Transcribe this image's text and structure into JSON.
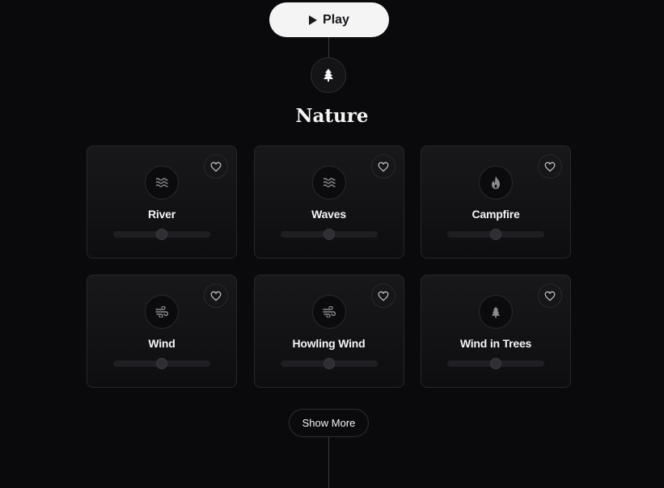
{
  "player": {
    "play_label": "Play",
    "play_icon": "play-icon"
  },
  "category": {
    "title": "Nature",
    "icon": "tree-icon"
  },
  "sounds": [
    {
      "name": "River",
      "icon": "waves-icon",
      "volume": 0.5,
      "favorited": false
    },
    {
      "name": "Waves",
      "icon": "waves-icon",
      "volume": 0.5,
      "favorited": false
    },
    {
      "name": "Campfire",
      "icon": "flame-icon",
      "volume": 0.5,
      "favorited": false
    },
    {
      "name": "Wind",
      "icon": "wind-icon",
      "volume": 0.5,
      "favorited": false
    },
    {
      "name": "Howling Wind",
      "icon": "wind-icon",
      "volume": 0.5,
      "favorited": false
    },
    {
      "name": "Wind in Trees",
      "icon": "tree-icon",
      "volume": 0.5,
      "favorited": false
    }
  ],
  "show_more_label": "Show More",
  "colors": {
    "background": "#0a0a0c",
    "play_button": "#f4f4f5",
    "icon": "#8a8a90"
  }
}
